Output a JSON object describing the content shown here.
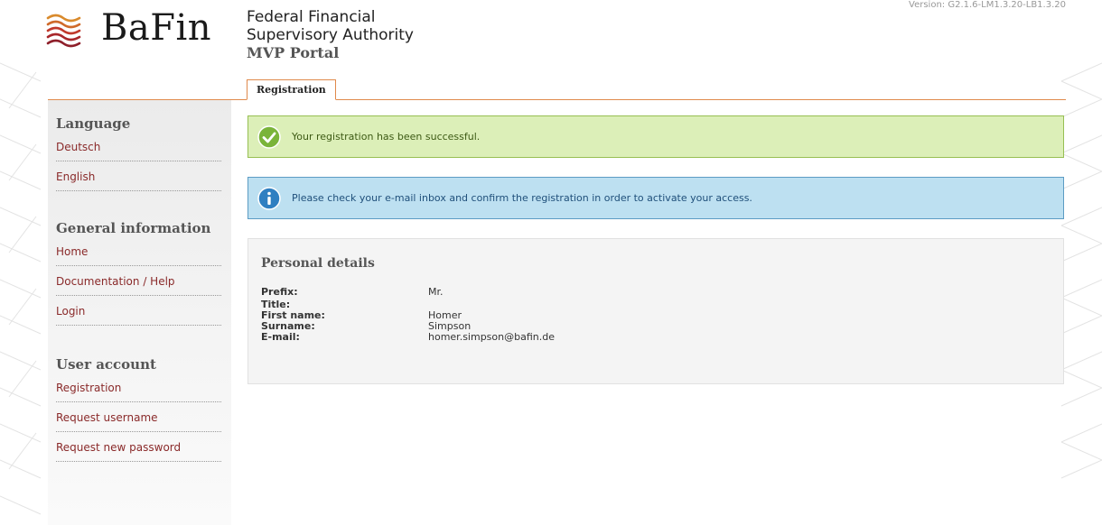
{
  "header": {
    "logo_text": "BaFin",
    "authority_line1": "Federal Financial",
    "authority_line2": "Supervisory Authority",
    "portal": "MVP Portal",
    "version": "Version: G2.1.6-LM1.3.20-LB1.3.20"
  },
  "tabs": [
    {
      "label": "Registration",
      "active": true
    }
  ],
  "sidebar": {
    "sections": [
      {
        "heading": "Language",
        "items": [
          {
            "label": "Deutsch"
          },
          {
            "label": "English"
          }
        ]
      },
      {
        "heading": "General information",
        "items": [
          {
            "label": "Home"
          },
          {
            "label": "Documentation / Help"
          },
          {
            "label": "Login"
          }
        ]
      },
      {
        "heading": "User account",
        "items": [
          {
            "label": "Registration"
          },
          {
            "label": "Request username"
          },
          {
            "label": "Request new password"
          }
        ]
      }
    ]
  },
  "alerts": {
    "success": "Your registration has been successful.",
    "info": "Please check your e-mail inbox and confirm the registration in order to activate your access."
  },
  "personal_details": {
    "heading": "Personal details",
    "rows": [
      {
        "label": "Prefix:",
        "value": "Mr."
      },
      {
        "label": "Title:",
        "value": ""
      },
      {
        "label": "First name:",
        "value": "Homer"
      },
      {
        "label": "Surname:",
        "value": "Simpson"
      },
      {
        "label": "E-mail:",
        "value": "homer.simpson@bafin.de"
      }
    ]
  },
  "colors": {
    "accent": "#e08a4c",
    "link": "#8a2a2a",
    "success_bg": "#dcefb8",
    "info_bg": "#bde0f1"
  },
  "icons": [
    "bafin-waves-logo",
    "checkmark-icon",
    "info-icon"
  ]
}
